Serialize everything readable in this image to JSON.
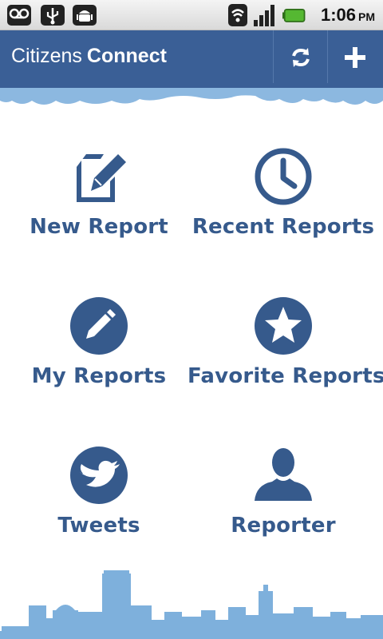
{
  "status_bar": {
    "time": "1:06",
    "ampm": "PM",
    "left_icons": [
      "voicemail-icon",
      "usb-icon",
      "android-debug-icon"
    ],
    "right_icons": [
      "wifi-icon",
      "signal-icon",
      "battery-icon"
    ]
  },
  "app_bar": {
    "title_regular": "Citizens",
    "title_bold": "Connect",
    "actions": [
      "refresh-icon",
      "add-icon"
    ]
  },
  "menu": [
    {
      "label": "New Report",
      "icon": "edit-report-icon"
    },
    {
      "label": "Recent Reports",
      "icon": "clock-icon"
    },
    {
      "label": "My Reports",
      "icon": "pencil-circle-icon"
    },
    {
      "label": "Favorite Reports",
      "icon": "star-circle-icon"
    },
    {
      "label": "Tweets",
      "icon": "twitter-bird-icon"
    },
    {
      "label": "Reporter",
      "icon": "person-icon"
    }
  ],
  "colors": {
    "primary": "#3a5f96",
    "label": "#365a8c",
    "cloud": "#8cb8e0",
    "skyline": "#7eb0dc"
  }
}
